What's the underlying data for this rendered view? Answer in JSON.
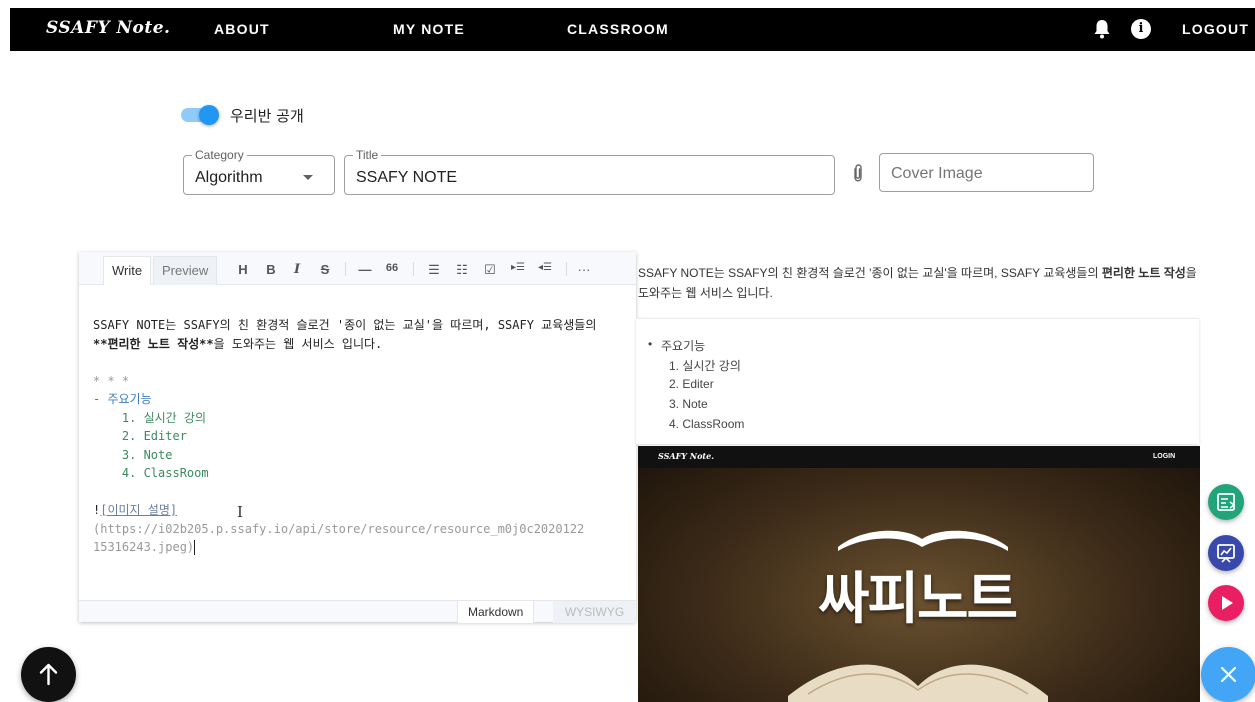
{
  "header": {
    "brand": "SSAFY Note.",
    "nav": [
      "ABOUT",
      "MY NOTE",
      "CLASSROOM"
    ],
    "logout": "LOGOUT",
    "info_glyph": "i"
  },
  "form": {
    "public_toggle_label": "우리반 공개",
    "public_toggle_on": true,
    "category": {
      "legend": "Category",
      "value": "Algorithm"
    },
    "title": {
      "legend": "Title",
      "value": "SSAFY NOTE"
    },
    "cover": {
      "placeholder": "Cover Image"
    }
  },
  "editor": {
    "tabs": [
      "Write",
      "Preview"
    ],
    "toolbar": [
      "H",
      "B",
      "I",
      "S",
      "—",
      "66",
      "☰",
      "☷",
      "☑",
      "▸☰",
      "◂☰",
      "···"
    ],
    "lines": {
      "p1": "SSAFY NOTE는 SSAFY의 친 환경적 슬로건 '종이 없는 교실'을 따르며, SSAFY 교육생들의",
      "p2a": "**편리한 노트 작성**",
      "p2b": "을 도와주는 웹 서비스 입니다.",
      "hr": "* * *",
      "li0": "- 주요기능",
      "li1": "    1. 실시간 강의",
      "li2": "    2. Editer",
      "li3": "    3. Note",
      "li4": "    4. ClassRoom",
      "img_bang": "!",
      "img_alt": "[이미지 설명]",
      "img_url1": "(https://i02b205.p.ssafy.io/api/store/resource/resource_m0j0c2020122",
      "img_url2": "15316243.jpeg)"
    },
    "modes": [
      "Markdown",
      "WYSIWYG"
    ]
  },
  "preview": {
    "intro_a": "SSAFY NOTE는 SSAFY의 친 환경적 슬로건 '종이 없는 교실'을 따르며, SSAFY 교육생들의 ",
    "intro_bold": "편리한 노트 작성",
    "intro_b": "을",
    "intro_c": "도와주는 웹 서비스 입니다.",
    "list_head": "주요기능",
    "list_items": [
      "1. 실시간 강의",
      "2. Editer",
      "3. Note",
      "4. ClassRoom"
    ],
    "cover_brand": "SSAFY Note.",
    "cover_login": "LOGIN",
    "cover_title": "싸피노트"
  },
  "colors": {
    "appbar": "#000000",
    "toggle": "#2196f3",
    "fab_notes": "#21a47a",
    "fab_lecture": "#3949ab",
    "fab_play": "#e91e63",
    "fab_close": "#42a5f5"
  },
  "icons": {
    "bell": "bell-icon",
    "info": "info-icon",
    "clip": "paperclip-icon",
    "top": "arrow-up-icon",
    "notes": "note-list-icon",
    "lecture": "presentation-icon",
    "play": "play-icon",
    "close": "close-icon"
  }
}
